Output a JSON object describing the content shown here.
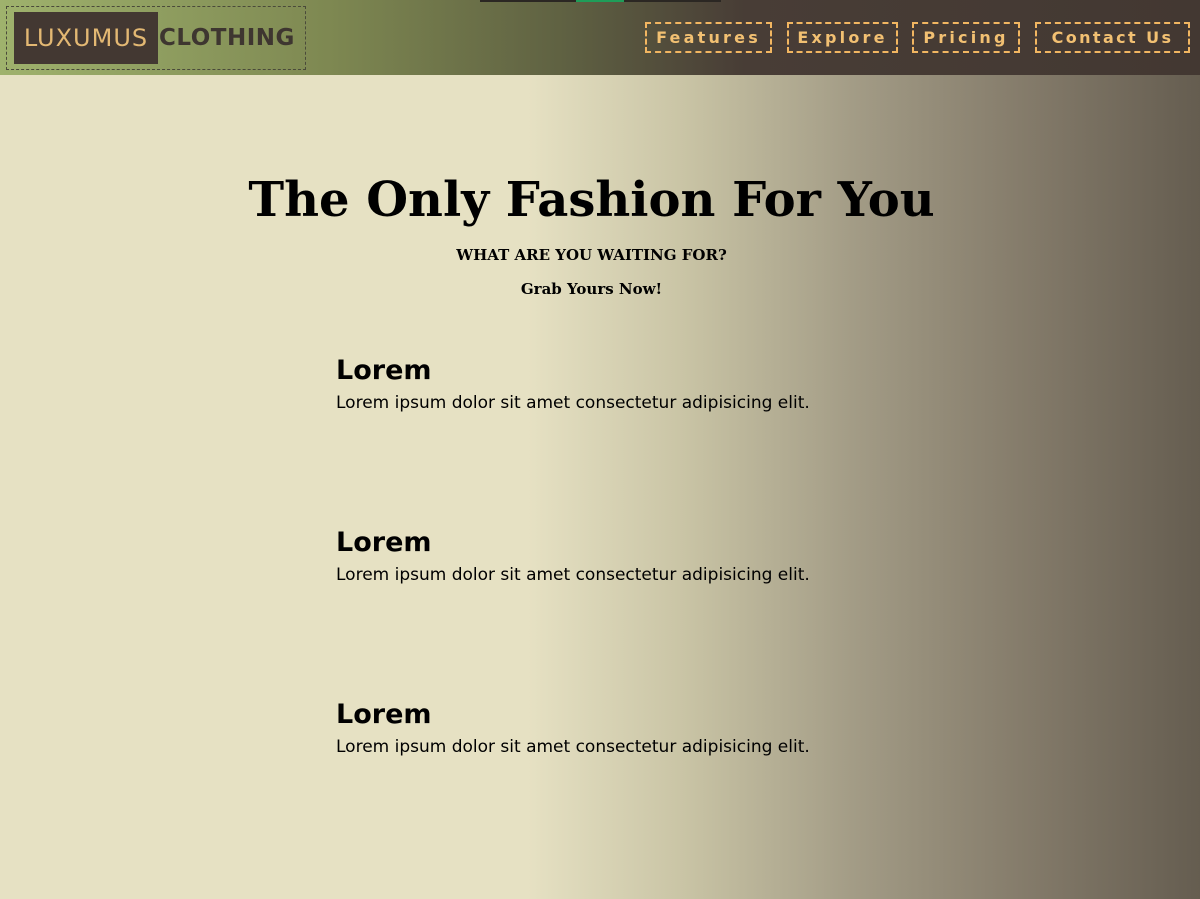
{
  "header": {
    "logo": {
      "word_1": "LUXUMUS",
      "word_2": "CLOTHING"
    },
    "nav": [
      {
        "label": "Features"
      },
      {
        "label": "Explore"
      },
      {
        "label": "Pricing"
      },
      {
        "label": "Contact Us"
      }
    ]
  },
  "hero": {
    "title": "The Only Fashion For You",
    "subtitle": "WHAT ARE YOU WAITING FOR?",
    "cta": "Grab Yours Now!"
  },
  "features": [
    {
      "title": "Lorem",
      "text": "Lorem ipsum dolor sit amet consectetur adipisicing elit."
    },
    {
      "title": "Lorem",
      "text": "Lorem ipsum dolor sit amet consectetur adipisicing elit."
    },
    {
      "title": "Lorem",
      "text": "Lorem ipsum dolor sit amet consectetur adipisicing elit."
    }
  ],
  "colors": {
    "accent": "#f2b661",
    "logo_dark": "#433832",
    "header_start": "#9fb26d",
    "page_light": "#e6e1c3",
    "page_dark": "#655d50"
  }
}
